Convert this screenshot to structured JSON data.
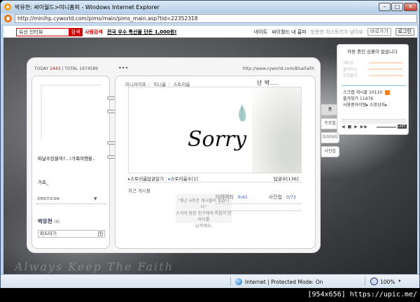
{
  "window": {
    "title": "박유천: 싸이월드>미니홈피 - Windows Internet Explorer",
    "min_glyph": "–",
    "max_glyph": "□",
    "close_glyph": "✕"
  },
  "addressbar": {
    "url": "http://minihp.cyworld.com/pims/main/pims_main.asp?tid=22352318"
  },
  "topbar": {
    "search_value": "유선 인터뷰",
    "search_button": "검색",
    "people_search": "사람검색",
    "headline": "전국 우수 특산물 단돈 1,000원!",
    "links": [
      "네이트",
      "싸이월드 내 홈피",
      "방문한 히스토리가 남아요"
    ],
    "shortcut": "바로가기",
    "login": "로그인"
  },
  "minihompy": {
    "today_label": "TODAY",
    "today_count": "2443",
    "total_label": "TOTAL",
    "total_count": "1974589",
    "dots": "•••",
    "hp_url": "http://www.cyworld.com/BlueFaith",
    "status_line1": "떠날수있을까?...!가족여행을..",
    "status_line2": "가죠_",
    "emoticon": "EMOTICON",
    "emoticon_arrow": "▼",
    "owner_name": "박유천",
    "owner_count": "(8)",
    "wave_label": "파도타기",
    "wave_plus": "+",
    "tabs": [
      "미니라이프",
      "미니룸",
      "스토리룸"
    ],
    "title": "난 박....",
    "banner_text": "Sorry",
    "link1": "스토리룸답글달기",
    "link2": "스토리룸수[1]",
    "guest_count": "답글수[136]",
    "recent_header": "최근 게시물",
    "recent_empty_line1": "\"최근 4주간 게시물이 없습니다\"",
    "recent_empty_line2": "소식이 뜸한 친구에게 마음의 한마디를",
    "recent_empty_line3": "남겨세요.",
    "diary_label": "다이어리",
    "diary_count": "0/43",
    "photo_label": "사진첩",
    "photo_count": "0/73",
    "side_tabs": [
      "홈",
      "프로필",
      "다이어리",
      "사진첩"
    ],
    "footer_motto": "Always Keep The Faith"
  },
  "widget": {
    "title": "자랑 중인 심볼이 없습니다",
    "rows": [
      "액티브",
      "쿨리마스",
      "프렌들리"
    ],
    "scrap_label": "스크랩 게시물",
    "scrap_count": "10110",
    "favorites_label": "즐겨찾기",
    "favorites_count": "11476",
    "shop_links": "사용중아이템▸ 소망상자▸",
    "player_controls": "◀ ■ ▶ ▶▶",
    "list_btn": "LIST"
  },
  "statusbar": {
    "zone": "Internet | Protected Mode: On",
    "zoom": "100%",
    "zoom_caret": "▾"
  },
  "watermark": {
    "text": "[954x656] https://upic.me/"
  },
  "colors": {
    "accent_red": "#cc0000",
    "link_blue": "#3355aa",
    "ie_frame": "#bcd3ea"
  }
}
